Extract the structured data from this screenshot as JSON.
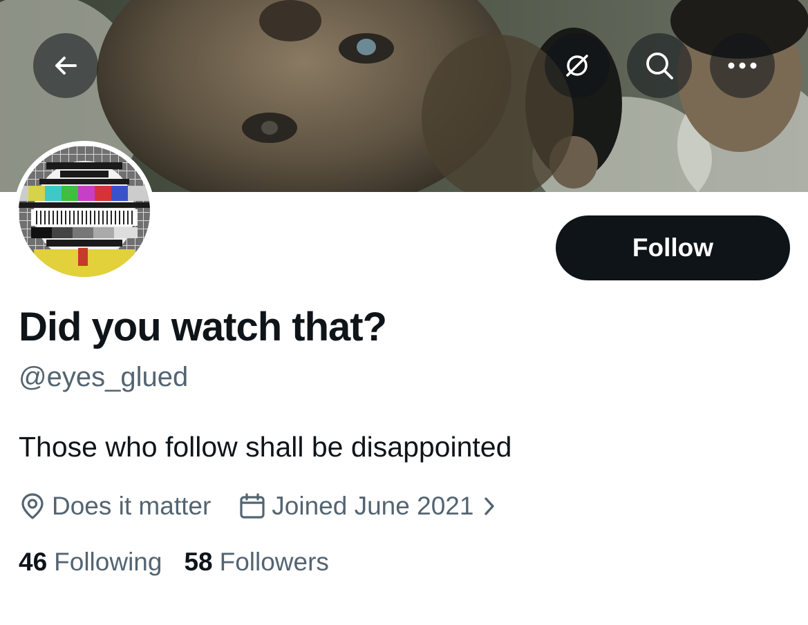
{
  "colors": {
    "text_primary": "#0f1419",
    "text_secondary": "#536471",
    "follow_button_bg": "#0f1419",
    "follow_button_text": "#ffffff",
    "overlay_button_bg": "rgba(15,20,25,0.55)"
  },
  "header": {
    "back_icon": "arrow-left-icon",
    "translate_icon": "translate-globe-icon",
    "search_icon": "search-icon",
    "more_icon": "more-horizontal-icon"
  },
  "profile": {
    "banner_image": "film-still-photo",
    "avatar_image": "tv-test-card",
    "follow_label": "Follow",
    "display_name": "Did you watch that?",
    "handle": "@eyes_glued",
    "bio": "Those who follow shall be disappointed",
    "location": "Does it matter",
    "location_icon": "location-pin-icon",
    "joined": "Joined June 2021",
    "joined_icon": "calendar-icon",
    "joined_chevron": "chevron-right-icon",
    "following_count": "46",
    "following_label": "Following",
    "followers_count": "58",
    "followers_label": "Followers"
  }
}
